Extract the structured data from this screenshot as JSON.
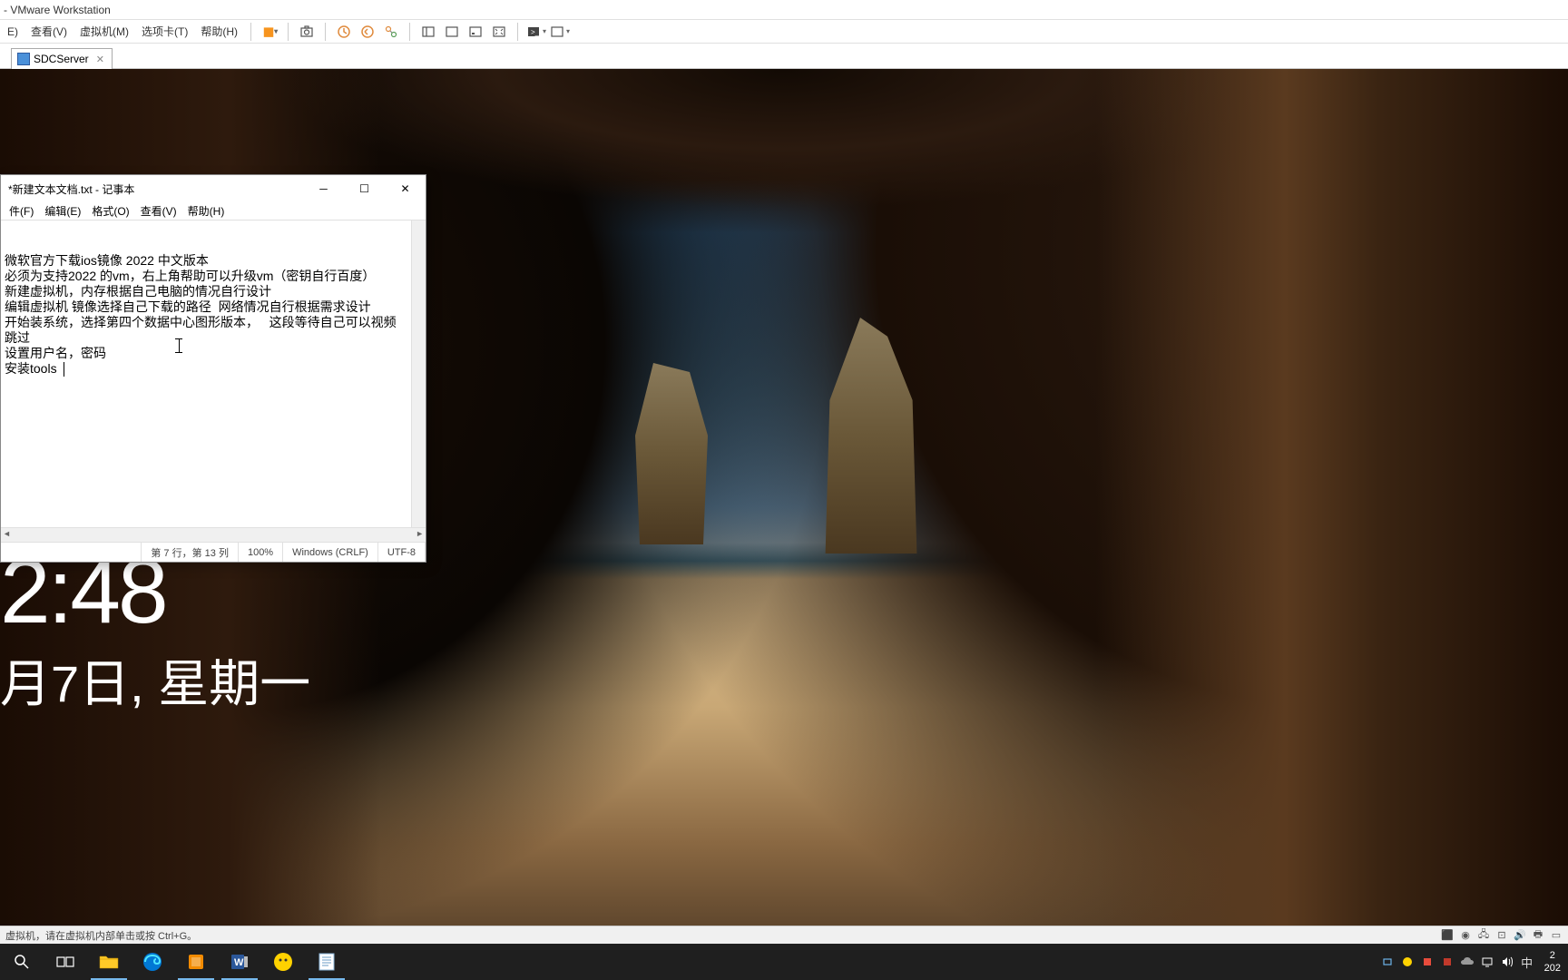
{
  "vmware": {
    "title": " - VMware Workstation",
    "menu": {
      "edit": "E)",
      "view": "查看(V)",
      "vm": "虚拟机(M)",
      "tabs": "选项卡(T)",
      "help": "帮助(H)"
    },
    "tab": {
      "name": "SDCServer"
    },
    "statusbar": "虚拟机，请在虚拟机内部单击或按 Ctrl+G。"
  },
  "notepad": {
    "title": "*新建文本文档.txt - 记事本",
    "menu": {
      "file": "件(F)",
      "edit": "编辑(E)",
      "format": "格式(O)",
      "view": "查看(V)",
      "help": "帮助(H)"
    },
    "lines": [
      "微软官方下载ios镜像 2022 中文版本",
      "必须为支持2022 的vm，右上角帮助可以升级vm（密钥自行百度）",
      "新建虚拟机，内存根据自己电脑的情况自行设计",
      "编辑虚拟机 镜像选择自己下载的路径  网络情况自行根据需求设计",
      "开始装系统，选择第四个数据中心图形版本，   这段等待自己可以视频跳过",
      "设置用户名，密码",
      "安装tools  "
    ],
    "status": {
      "pos": "第 7 行，第 13 列",
      "zoom": "100%",
      "eol": "Windows (CRLF)",
      "enc": "UTF-8"
    }
  },
  "lockscreen": {
    "time": "2:48",
    "date": "月7日, 星期一"
  },
  "taskbar": {
    "ime": "中",
    "time": "2",
    "date": "202"
  }
}
